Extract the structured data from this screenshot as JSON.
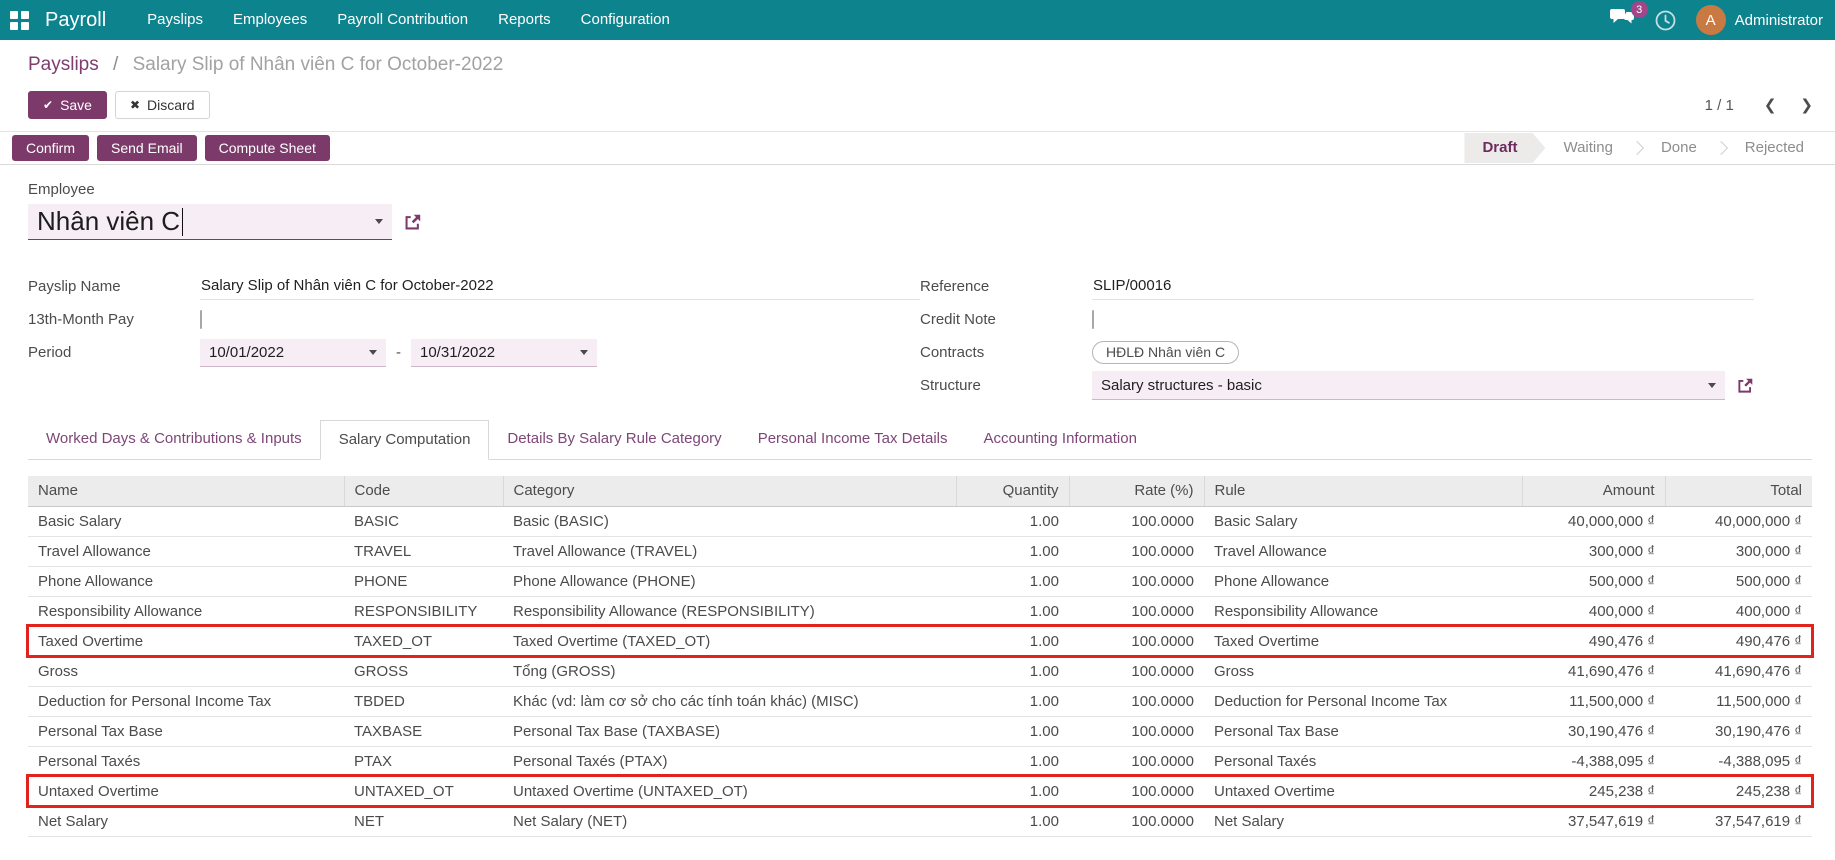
{
  "theme": {
    "navbar_bg": "#0d838e",
    "primary": "#7c3a6b",
    "link": "#7d3e6f",
    "highlight_red": "#e0231c",
    "field_bg": "#f6edf5",
    "badge_bg": "#a24689",
    "avatar_bg": "#c87a42"
  },
  "navbar": {
    "app_name": "Payroll",
    "menu": [
      "Payslips",
      "Employees",
      "Payroll Contribution",
      "Reports",
      "Configuration"
    ],
    "messages_badge": "3",
    "user": {
      "initial": "A",
      "name": "Administrator"
    }
  },
  "control_panel": {
    "breadcrumb": {
      "parent": "Payslips",
      "separator": "/",
      "current": "Salary Slip of Nhân viên C for October-2022"
    },
    "save_label": "Save",
    "discard_label": "Discard",
    "pager": {
      "value": "1 / 1"
    }
  },
  "action_row": {
    "buttons": [
      "Confirm",
      "Send Email",
      "Compute Sheet"
    ],
    "statusbar": {
      "states": [
        "Draft",
        "Waiting",
        "Done",
        "Rejected"
      ],
      "active_index": 0
    }
  },
  "form": {
    "employee": {
      "label": "Employee",
      "value": "Nhân viên C"
    },
    "payslip_name": {
      "label": "Payslip Name",
      "value": "Salary Slip of Nhân viên C for October-2022"
    },
    "thirteenth_month": {
      "label": "13th-Month Pay",
      "checked": false
    },
    "period": {
      "label": "Period",
      "from": "10/01/2022",
      "separator": "-",
      "to": "10/31/2022"
    },
    "reference": {
      "label": "Reference",
      "value": "SLIP/00016"
    },
    "credit_note": {
      "label": "Credit Note",
      "checked": false
    },
    "contracts": {
      "label": "Contracts",
      "tag": "HĐLĐ Nhân viên C"
    },
    "structure": {
      "label": "Structure",
      "value": "Salary structures - basic"
    }
  },
  "tabs": {
    "items": [
      "Worked Days & Contributions & Inputs",
      "Salary Computation",
      "Details By Salary Rule Category",
      "Personal Income Tax Details",
      "Accounting Information"
    ],
    "active_index": 1
  },
  "table": {
    "columns": [
      {
        "label": "Name",
        "align": "left"
      },
      {
        "label": "Code",
        "align": "left"
      },
      {
        "label": "Category",
        "align": "left"
      },
      {
        "label": "Quantity",
        "align": "right"
      },
      {
        "label": "Rate (%)",
        "align": "right"
      },
      {
        "label": "Rule",
        "align": "left"
      },
      {
        "label": "Amount",
        "align": "right"
      },
      {
        "label": "Total",
        "align": "right"
      }
    ],
    "rows": [
      {
        "name": "Basic Salary",
        "code": "BASIC",
        "category": "Basic (BASIC)",
        "quantity": "1.00",
        "rate": "100.0000",
        "rule": "Basic Salary",
        "amount": "40,000,000 ₫",
        "total": "40,000,000 ₫",
        "highlighted": false
      },
      {
        "name": "Travel Allowance",
        "code": "TRAVEL",
        "category": "Travel Allowance (TRAVEL)",
        "quantity": "1.00",
        "rate": "100.0000",
        "rule": "Travel Allowance",
        "amount": "300,000 ₫",
        "total": "300,000 ₫",
        "highlighted": false
      },
      {
        "name": "Phone Allowance",
        "code": "PHONE",
        "category": "Phone Allowance (PHONE)",
        "quantity": "1.00",
        "rate": "100.0000",
        "rule": "Phone Allowance",
        "amount": "500,000 ₫",
        "total": "500,000 ₫",
        "highlighted": false
      },
      {
        "name": "Responsibility Allowance",
        "code": "RESPONSIBILITY",
        "category": "Responsibility Allowance (RESPONSIBILITY)",
        "quantity": "1.00",
        "rate": "100.0000",
        "rule": "Responsibility Allowance",
        "amount": "400,000 ₫",
        "total": "400,000 ₫",
        "highlighted": false
      },
      {
        "name": "Taxed Overtime",
        "code": "TAXED_OT",
        "category": "Taxed Overtime (TAXED_OT)",
        "quantity": "1.00",
        "rate": "100.0000",
        "rule": "Taxed Overtime",
        "amount": "490,476 ₫",
        "total": "490,476 ₫",
        "highlighted": true
      },
      {
        "name": "Gross",
        "code": "GROSS",
        "category": "Tổng (GROSS)",
        "quantity": "1.00",
        "rate": "100.0000",
        "rule": "Gross",
        "amount": "41,690,476 ₫",
        "total": "41,690,476 ₫",
        "highlighted": false
      },
      {
        "name": "Deduction for Personal Income Tax",
        "code": "TBDED",
        "category": "Khác (vd: làm cơ sở cho các tính toán khác) (MISC)",
        "quantity": "1.00",
        "rate": "100.0000",
        "rule": "Deduction for Personal Income Tax",
        "amount": "11,500,000 ₫",
        "total": "11,500,000 ₫",
        "highlighted": false
      },
      {
        "name": "Personal Tax Base",
        "code": "TAXBASE",
        "category": "Personal Tax Base (TAXBASE)",
        "quantity": "1.00",
        "rate": "100.0000",
        "rule": "Personal Tax Base",
        "amount": "30,190,476 ₫",
        "total": "30,190,476 ₫",
        "highlighted": false
      },
      {
        "name": "Personal Taxés",
        "code": "PTAX",
        "category": "Personal Taxés (PTAX)",
        "quantity": "1.00",
        "rate": "100.0000",
        "rule": "Personal Taxés",
        "amount": "-4,388,095 ₫",
        "total": "-4,388,095 ₫",
        "highlighted": false
      },
      {
        "name": "Untaxed Overtime",
        "code": "UNTAXED_OT",
        "category": "Untaxed Overtime (UNTAXED_OT)",
        "quantity": "1.00",
        "rate": "100.0000",
        "rule": "Untaxed Overtime",
        "amount": "245,238 ₫",
        "total": "245,238 ₫",
        "highlighted": true
      },
      {
        "name": "Net Salary",
        "code": "NET",
        "category": "Net Salary (NET)",
        "quantity": "1.00",
        "rate": "100.0000",
        "rule": "Net Salary",
        "amount": "37,547,619 ₫",
        "total": "37,547,619 ₫",
        "highlighted": false
      }
    ]
  }
}
